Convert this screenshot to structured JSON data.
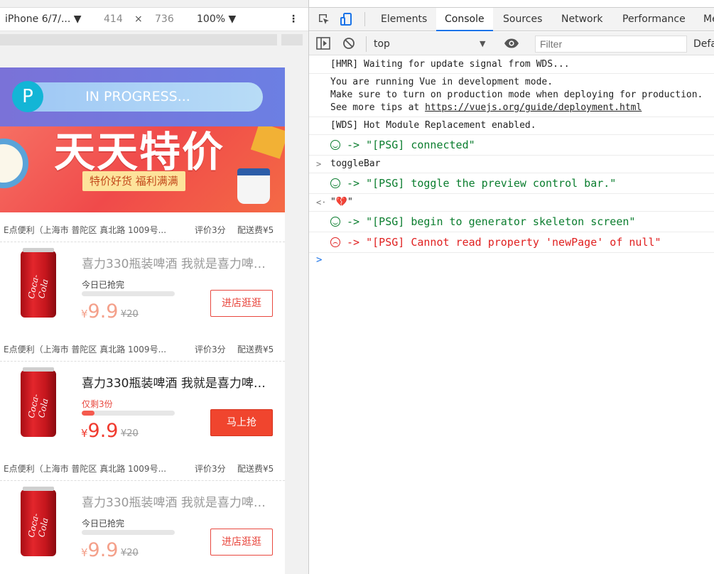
{
  "device_toolbar": {
    "device": "iPhone 6/7/... ▼",
    "width": "414",
    "times": "×",
    "height": "736",
    "zoom": "100% ▼",
    "more": "⋮"
  },
  "phone": {
    "progress": {
      "badge": "P",
      "text": "IN PROGRESS..."
    },
    "banner": {
      "title": "天天特价",
      "subtitle": "特价好货  福利满满"
    },
    "shops": [
      {
        "name": "E点便利（上海市 普陀区 真北路 1009号...",
        "rating": "评价3分",
        "fee": "配送费¥5"
      },
      {
        "name": "E点便利（上海市 普陀区 真北路 1009号...",
        "rating": "评价3分",
        "fee": "配送费¥5"
      },
      {
        "name": "E点便利（上海市 普陀区 真北路 1009号...",
        "rating": "评价3分",
        "fee": "配送费¥5"
      }
    ],
    "items": [
      {
        "title": "喜力330瓶装啤酒 我就是喜力啤酒...",
        "status": "今日已抢完",
        "progress": 0,
        "currency": "¥",
        "price": "9.9",
        "old_price": "¥20",
        "button": "进店逛逛",
        "can_logo": "Coca-Cola"
      },
      {
        "title": "喜力330瓶装啤酒 我就是喜力啤酒...",
        "status": "仅剩3份",
        "progress": 0.14,
        "currency": "¥",
        "price": "9.9",
        "old_price": "¥20",
        "button": "马上抢",
        "can_logo": "Coca-Cola"
      },
      {
        "title": "喜力330瓶装啤酒 我就是喜力啤酒...",
        "status": "今日已抢完",
        "progress": 0,
        "currency": "¥",
        "price": "9.9",
        "old_price": "¥20",
        "button": "进店逛逛",
        "can_logo": "Coca-Cola"
      }
    ]
  },
  "devtools": {
    "tabs": [
      "Elements",
      "Console",
      "Sources",
      "Network",
      "Performance",
      "Me"
    ],
    "active_tab": "Console",
    "accent": "#1a73e8",
    "context": "top",
    "filter_placeholder": "Filter",
    "levels": "Defa",
    "logs": [
      {
        "text": "[HMR] Waiting for update signal from WDS...",
        "style": "normal"
      },
      {
        "text": "You are running Vue in development mode.\nMake sure to turn on production mode when deploying for production.\nSee more tips at ",
        "link": "https://vuejs.org/guide/deployment.html",
        "style": "normal"
      },
      {
        "text": "[WDS] Hot Module Replacement enabled.",
        "style": "normal"
      },
      {
        "text": "-> \"[PSG] connected\"",
        "style": "green",
        "icon": "smile"
      },
      {
        "text": "toggleBar",
        "style": "input",
        "chev": ">"
      },
      {
        "text": "-> \"[PSG] toggle the preview control bar.\"",
        "style": "green",
        "icon": "smile"
      },
      {
        "text": "\"💔\"",
        "style": "result",
        "chev": "<·"
      },
      {
        "text": "-> \"[PSG] begin to generator skeleton screen\"",
        "style": "green",
        "icon": "smile"
      },
      {
        "text": "-> \"[PSG] Cannot read property 'newPage' of null\"",
        "style": "red",
        "icon": "sad"
      }
    ],
    "prompt": ">"
  }
}
